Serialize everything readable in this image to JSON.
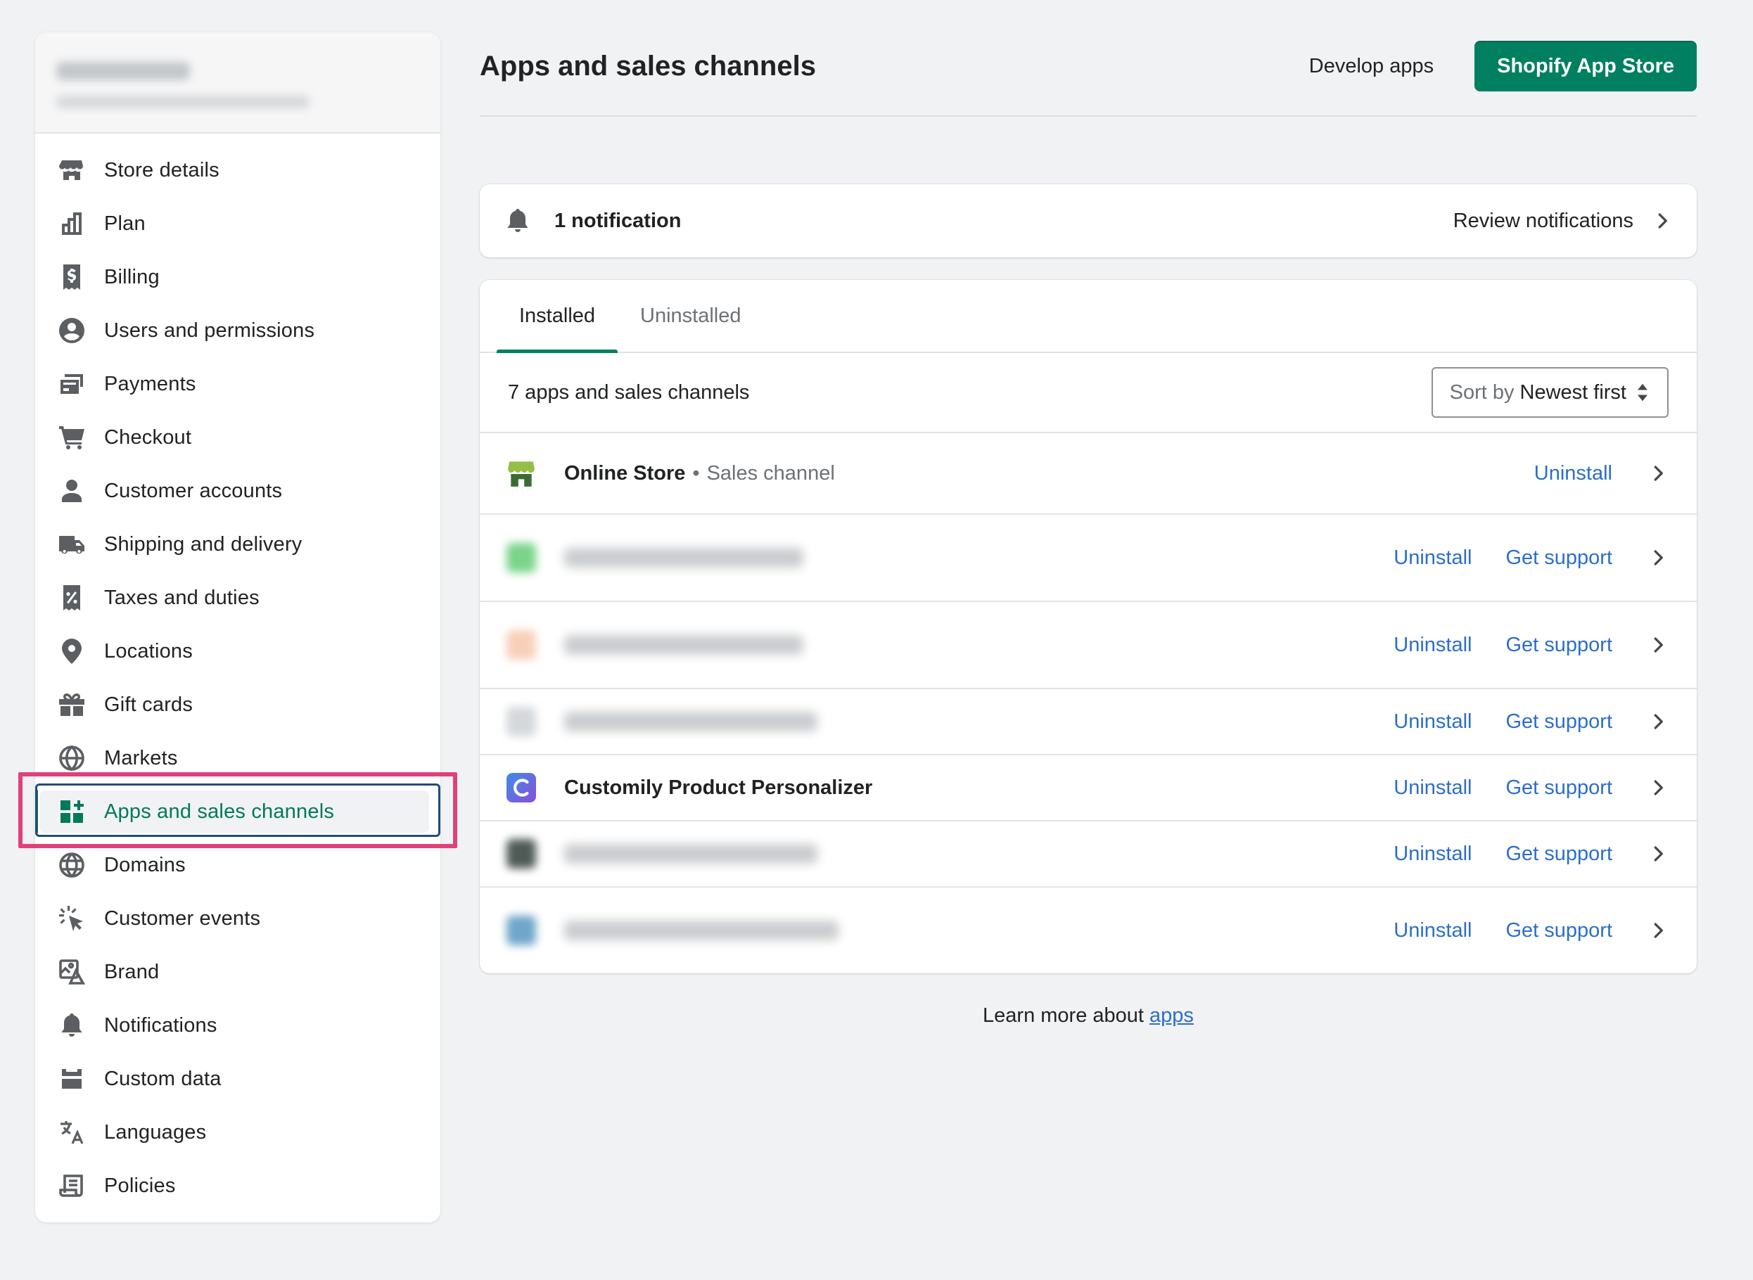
{
  "sidebar": {
    "items": [
      {
        "label": "Store details",
        "icon": "store-icon"
      },
      {
        "label": "Plan",
        "icon": "plan-icon"
      },
      {
        "label": "Billing",
        "icon": "billing-icon"
      },
      {
        "label": "Users and permissions",
        "icon": "user-circle-icon"
      },
      {
        "label": "Payments",
        "icon": "payments-icon"
      },
      {
        "label": "Checkout",
        "icon": "cart-icon"
      },
      {
        "label": "Customer accounts",
        "icon": "person-icon"
      },
      {
        "label": "Shipping and delivery",
        "icon": "truck-icon"
      },
      {
        "label": "Taxes and duties",
        "icon": "tax-receipt-icon"
      },
      {
        "label": "Locations",
        "icon": "location-pin-icon"
      },
      {
        "label": "Gift cards",
        "icon": "gift-icon"
      },
      {
        "label": "Markets",
        "icon": "globe-markets-icon"
      },
      {
        "label": "Apps and sales channels",
        "icon": "apps-icon",
        "active": true
      },
      {
        "label": "Domains",
        "icon": "globe-icon"
      },
      {
        "label": "Customer events",
        "icon": "cursor-click-icon"
      },
      {
        "label": "Brand",
        "icon": "brand-icon"
      },
      {
        "label": "Notifications",
        "icon": "bell-icon"
      },
      {
        "label": "Custom data",
        "icon": "custom-data-icon"
      },
      {
        "label": "Languages",
        "icon": "translate-icon"
      },
      {
        "label": "Policies",
        "icon": "policy-icon"
      }
    ]
  },
  "header": {
    "title": "Apps and sales channels",
    "develop_label": "Develop apps",
    "store_button": "Shopify App Store"
  },
  "notification": {
    "text": "1 notification",
    "review_label": "Review notifications"
  },
  "tabs": [
    {
      "label": "Installed",
      "active": true
    },
    {
      "label": "Uninstalled",
      "active": false
    }
  ],
  "list": {
    "count_text": "7 apps and sales channels",
    "sort_prefix": "Sort by",
    "sort_value": "Newest first",
    "uninstall_label": "Uninstall",
    "support_label": "Get support",
    "rows": [
      {
        "name": "Online Store",
        "sep": "•",
        "type": "Sales channel",
        "blurred": false,
        "support": false,
        "icon_color": "#5e8e3e"
      },
      {
        "blurred": true,
        "support": true,
        "icon_color": "#7ad48a"
      },
      {
        "blurred": true,
        "support": true,
        "icon_color": "#f3b08c"
      },
      {
        "blurred": true,
        "support": true,
        "icon_color": "#d5d8db"
      },
      {
        "name": "Customily Product Personalizer",
        "blurred": false,
        "support": true,
        "icon_color": "#6b62d6"
      },
      {
        "blurred": true,
        "support": true,
        "icon_color": "#4f5a56"
      },
      {
        "blurred": true,
        "support": true,
        "icon_color": "#6fa6c9"
      }
    ]
  },
  "footer": {
    "learn_prefix": "Learn more about",
    "learn_link": "apps"
  },
  "colors": {
    "accent": "#008060",
    "link": "#2c6ecb",
    "highlight": "#e0407b"
  }
}
